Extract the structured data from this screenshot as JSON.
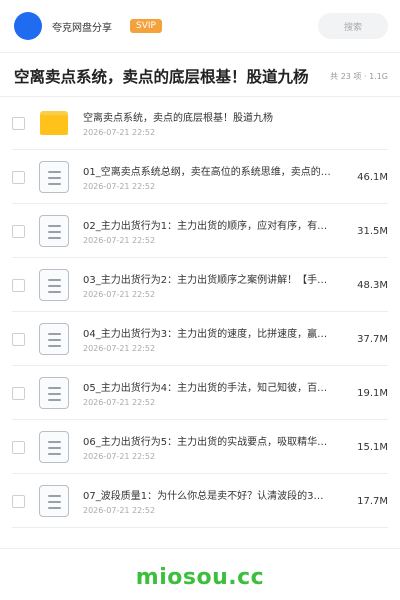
{
  "header": {
    "share_name": "夸克网盘分享",
    "badge": "SVIP",
    "search_placeholder": "搜索"
  },
  "title_bar": {
    "title": "空离卖点系统，卖点的底层根基！股道九杨",
    "meta": "共 23 项 · 1.1G"
  },
  "items": [
    {
      "type": "folder",
      "name": "空离卖点系统，卖点的底层根基！股道九杨",
      "date": "2026-07-21 22:52",
      "size": ""
    },
    {
      "type": "file",
      "name": "01_空离卖点系统总纲，卖在高位的系统思维，卖点的…",
      "date": "2026-07-21 22:52",
      "size": "46.1M"
    },
    {
      "type": "file",
      "name": "02_主力出货行为1：主力出货的顺序，应对有序，有…",
      "date": "2026-07-21 22:52",
      "size": "31.5M"
    },
    {
      "type": "file",
      "name": "03_主力出货行为2：主力出货顺序之案例讲解！【手…",
      "date": "2026-07-21 22:52",
      "size": "48.3M"
    },
    {
      "type": "file",
      "name": "04_主力出货行为3：主力出货的速度，比拼速度，赢…",
      "date": "2026-07-21 22:52",
      "size": "37.7M"
    },
    {
      "type": "file",
      "name": "05_主力出货行为4：主力出货的手法，知己知彼，百…",
      "date": "2026-07-21 22:52",
      "size": "19.1M"
    },
    {
      "type": "file",
      "name": "06_主力出货行为5：主力出货的实战要点，吸取精华…",
      "date": "2026-07-21 22:52",
      "size": "15.1M"
    },
    {
      "type": "file",
      "name": "07_波段质量1：为什么你总是卖不好？认清波段的3…",
      "date": "2026-07-21 22:52",
      "size": "17.7M"
    }
  ],
  "footer": {
    "brand": "miosou.cc"
  },
  "colors": {
    "accent_blue": "#1f6cf0",
    "svip_orange": "#f4a23b",
    "folder_yellow": "#ffc21a",
    "brand_green": "#3cbf3c"
  }
}
